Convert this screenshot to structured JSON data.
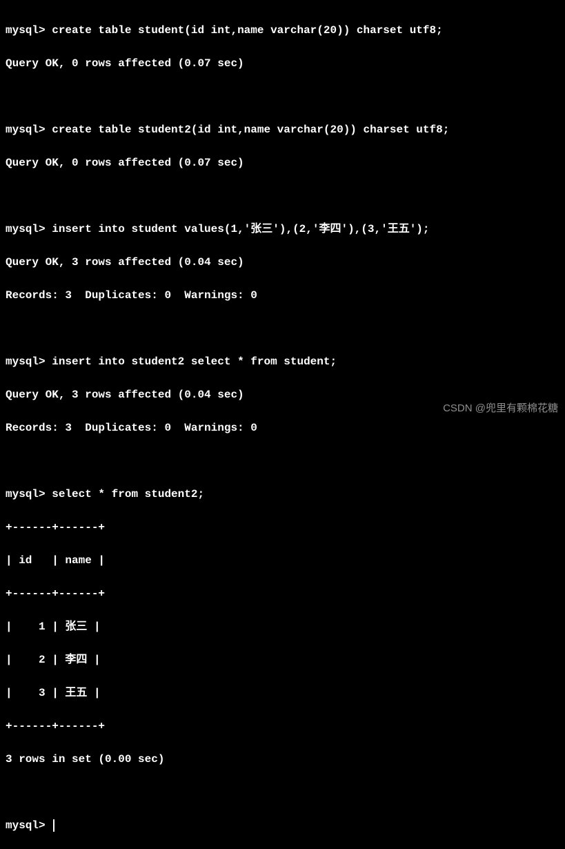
{
  "prompt": "mysql> ",
  "commands": {
    "cmd1": "create table student(id int,name varchar(20)) charset utf8;",
    "res1a": "Query OK, 0 rows affected (0.07 sec)",
    "cmd2": "create table student2(id int,name varchar(20)) charset utf8;",
    "res2a": "Query OK, 0 rows affected (0.07 sec)",
    "cmd3": "insert into student values(1,'张三'),(2,'李四'),(3,'王五');",
    "res3a": "Query OK, 3 rows affected (0.04 sec)",
    "res3b": "Records: 3  Duplicates: 0  Warnings: 0",
    "cmd4": "insert into student2 select * from student;",
    "res4a": "Query OK, 3 rows affected (0.04 sec)",
    "res4b": "Records: 3  Duplicates: 0  Warnings: 0",
    "cmd5": "select * from student2;",
    "table_border": "+------+------+",
    "table_header": "| id   | name |",
    "table_row1": "|    1 | 张三 |",
    "table_row2": "|    2 | 李四 |",
    "table_row3": "|    3 | 王五 |",
    "res5a": "3 rows in set (0.00 sec)"
  },
  "watermark": "CSDN @兜里有颗棉花糖"
}
